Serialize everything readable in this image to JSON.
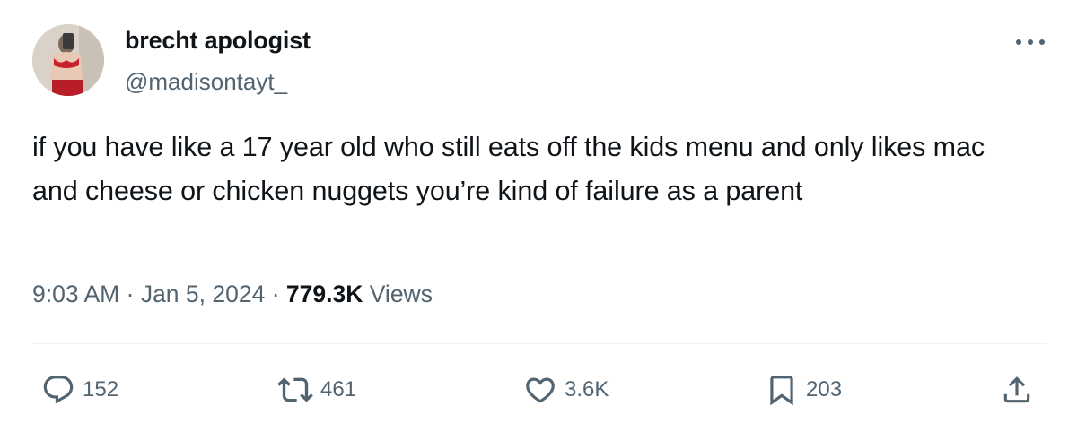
{
  "author": {
    "display_name": "brecht apologist",
    "handle": "@madisontayt_",
    "avatar_icon": "profile-photo"
  },
  "tweet": {
    "text": "if you have like a 17 year old who still eats off the kids menu and only likes mac and cheese or chicken nuggets you’re kind of failure as a parent",
    "time": "9:03 AM",
    "separator": "·",
    "date": "Jan 5, 2024",
    "views_count": "779.3K",
    "views_label": "Views"
  },
  "actions": {
    "reply_count": "152",
    "retweet_count": "461",
    "like_count": "3.6K",
    "bookmark_count": "203"
  },
  "colors": {
    "text_primary": "#0f1419",
    "text_secondary": "#536471",
    "divider": "#eff3f4"
  }
}
